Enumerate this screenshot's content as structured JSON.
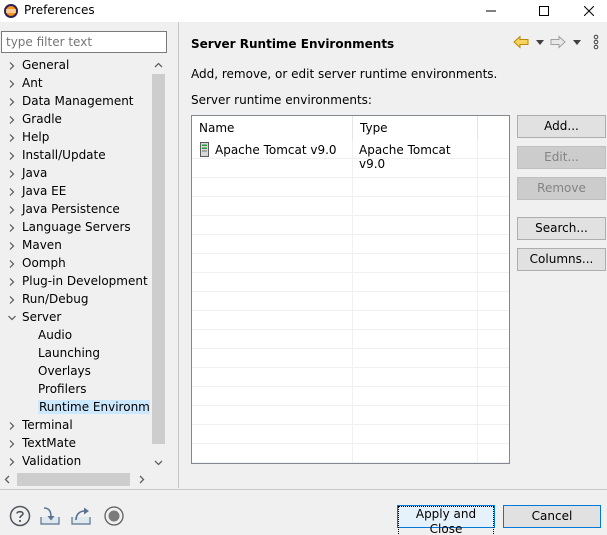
{
  "window": {
    "title": "Preferences",
    "icons": {
      "app": "eclipse-icon",
      "minimize": "minimize-icon",
      "maximize": "maximize-icon",
      "close": "close-icon"
    }
  },
  "sidebar": {
    "filter_placeholder": "type filter text",
    "items": [
      {
        "label": "General",
        "level": 0,
        "expander": "collapsed"
      },
      {
        "label": "Ant",
        "level": 0,
        "expander": "collapsed"
      },
      {
        "label": "Data Management",
        "level": 0,
        "expander": "collapsed"
      },
      {
        "label": "Gradle",
        "level": 0,
        "expander": "collapsed"
      },
      {
        "label": "Help",
        "level": 0,
        "expander": "collapsed"
      },
      {
        "label": "Install/Update",
        "level": 0,
        "expander": "collapsed"
      },
      {
        "label": "Java",
        "level": 0,
        "expander": "collapsed"
      },
      {
        "label": "Java EE",
        "level": 0,
        "expander": "collapsed"
      },
      {
        "label": "Java Persistence",
        "level": 0,
        "expander": "collapsed"
      },
      {
        "label": "Language Servers",
        "level": 0,
        "expander": "collapsed"
      },
      {
        "label": "Maven",
        "level": 0,
        "expander": "collapsed"
      },
      {
        "label": "Oomph",
        "level": 0,
        "expander": "collapsed"
      },
      {
        "label": "Plug-in Development",
        "level": 0,
        "expander": "collapsed"
      },
      {
        "label": "Run/Debug",
        "level": 0,
        "expander": "collapsed"
      },
      {
        "label": "Server",
        "level": 0,
        "expander": "expanded"
      },
      {
        "label": "Audio",
        "level": 1,
        "expander": "none"
      },
      {
        "label": "Launching",
        "level": 1,
        "expander": "none"
      },
      {
        "label": "Overlays",
        "level": 1,
        "expander": "none"
      },
      {
        "label": "Profilers",
        "level": 1,
        "expander": "none"
      },
      {
        "label": "Runtime Environmen",
        "level": 1,
        "expander": "none",
        "selected": true
      },
      {
        "label": "Terminal",
        "level": 0,
        "expander": "collapsed"
      },
      {
        "label": "TextMate",
        "level": 0,
        "expander": "collapsed"
      },
      {
        "label": "Validation",
        "level": 0,
        "expander": "collapsed"
      }
    ]
  },
  "page": {
    "title": "Server Runtime Environments",
    "description": "Add, remove, or edit server runtime environments.",
    "list_label": "Server runtime environments:",
    "nav_icons": {
      "back": "back-arrow-icon",
      "forward": "forward-arrow-icon",
      "menu": "view-menu-icon"
    }
  },
  "table": {
    "columns": [
      "Name",
      "Type"
    ],
    "rows": [
      {
        "name": "Apache Tomcat v9.0",
        "type": "Apache Tomcat v9.0",
        "icon": "server-runtime-icon"
      }
    ]
  },
  "buttons": {
    "add": "Add...",
    "edit": "Edit...",
    "remove": "Remove",
    "search": "Search...",
    "columns": "Columns..."
  },
  "footer": {
    "icons": [
      "help-icon",
      "import-icon",
      "export-icon",
      "record-icon"
    ],
    "apply_close": "Apply and Close",
    "cancel": "Cancel"
  },
  "colors": {
    "selection": "#cce8ff",
    "default_button_border": "#0078d7",
    "back_arrow": "#e8b50a"
  }
}
